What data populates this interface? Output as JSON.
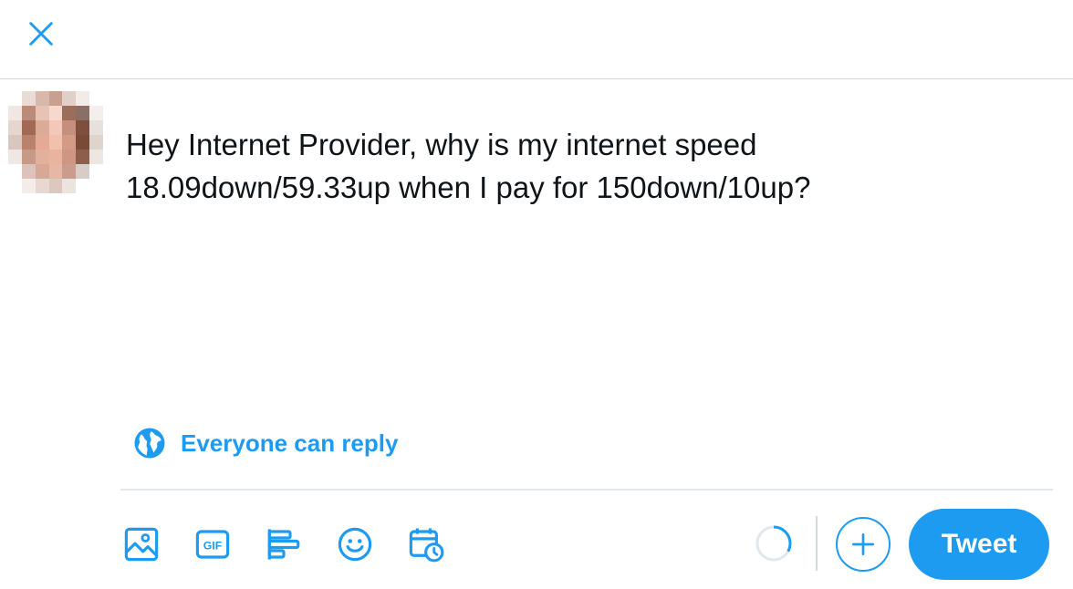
{
  "compose": {
    "text": "Hey Internet Provider, why is my internet speed\n18.09down/59.33up when I pay for 150down/10up?"
  },
  "reply_setting": {
    "label": "Everyone can reply"
  },
  "toolbar": {
    "icons": [
      "image-icon",
      "gif-icon",
      "poll-icon",
      "emoji-icon",
      "schedule-icon"
    ],
    "gif_text": "GIF",
    "tweet_label": "Tweet"
  },
  "colors": {
    "accent": "#1d9bf0",
    "text": "#0f1419",
    "divider": "#e1e8ed",
    "progress_track": "#e1e8ed",
    "progress_fill": "#1d9bf0"
  },
  "character_progress": 0.33
}
